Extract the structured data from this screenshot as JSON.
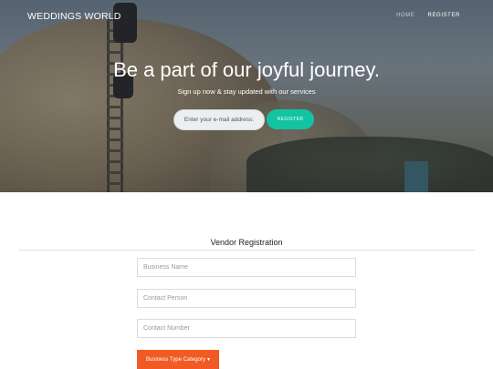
{
  "header": {
    "brand": "WEDDINGS WORLD",
    "nav": [
      {
        "label": "HOME"
      },
      {
        "label": "REGISTER"
      }
    ]
  },
  "hero": {
    "headline": "Be a part of our joyful journey.",
    "subtext": "Sign up now & stay updated with our services",
    "email_placeholder": "Enter your e-mail address:",
    "register_label": "REGISTER"
  },
  "form": {
    "title": "Vendor Registration",
    "business_name_placeholder": "Business Name",
    "contact_person_placeholder": "Contact Person",
    "contact_number_placeholder": "Contact Number",
    "category_label": "Business Type Category",
    "category_caret": "▾"
  },
  "colors": {
    "accent_teal": "#12c4a2",
    "accent_orange": "#f15a24"
  }
}
